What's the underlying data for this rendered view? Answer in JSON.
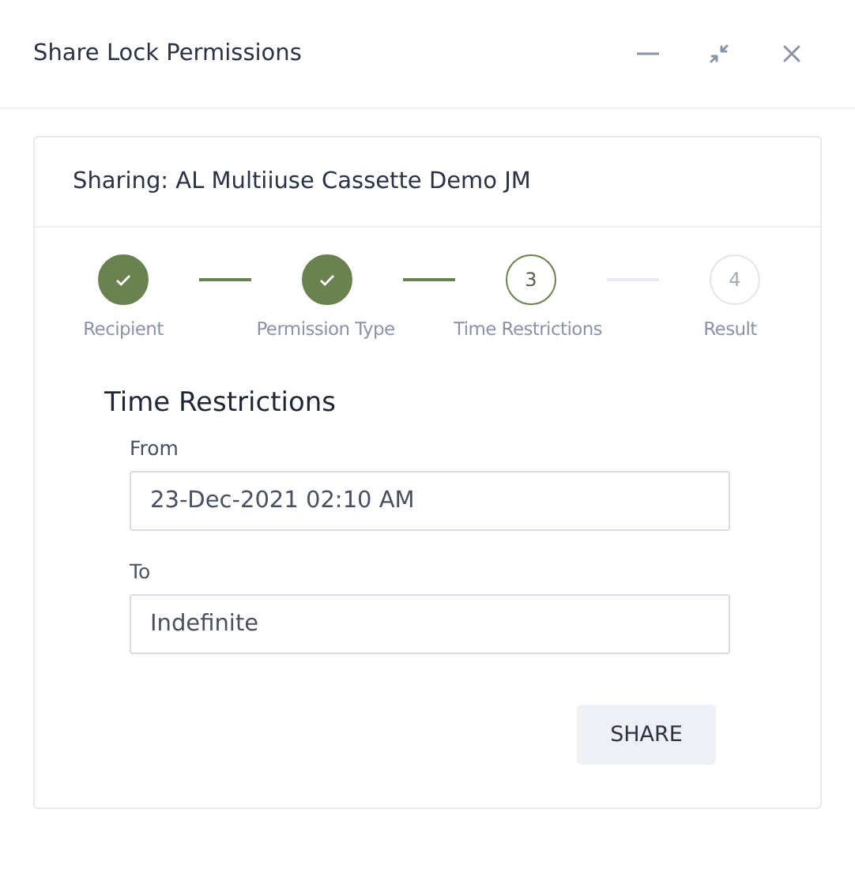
{
  "window": {
    "title": "Share Lock Permissions"
  },
  "card": {
    "title": "Sharing: AL Multiiuse Cassette Demo JM"
  },
  "steps": [
    {
      "label": "Recipient",
      "completed": true,
      "current": false
    },
    {
      "label": "Permission Type",
      "completed": true,
      "current": false
    },
    {
      "label": "Time Restrictions",
      "number": "3",
      "completed": false,
      "current": true
    },
    {
      "label": "Result",
      "number": "4",
      "completed": false,
      "current": false
    }
  ],
  "form": {
    "title": "Time Restrictions",
    "fields": [
      {
        "label": "From",
        "value": "23-Dec-2021 02:10 AM"
      },
      {
        "label": "To",
        "value": "Indefinite"
      }
    ],
    "button": "SHARE"
  }
}
